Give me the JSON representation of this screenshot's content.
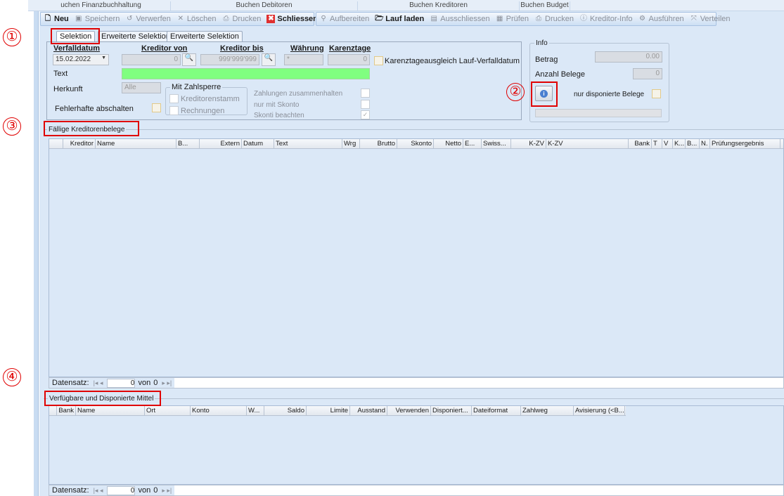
{
  "nav_tabs": [
    "uchen Finanzbuchhaltung",
    "Buchen Debitoren",
    "Buchen Kreditoren",
    "Buchen Budget"
  ],
  "toolbar1": [
    {
      "label": "Neu",
      "icon": "new-document-icon",
      "enabled": true
    },
    {
      "label": "Speichern",
      "icon": "save-icon",
      "enabled": false
    },
    {
      "label": "Verwerfen",
      "icon": "discard-icon",
      "enabled": false
    },
    {
      "label": "Löschen",
      "icon": "delete-x-icon",
      "enabled": false
    },
    {
      "label": "Drucken",
      "icon": "print-icon",
      "enabled": false
    },
    {
      "label": "Schliessen",
      "icon": "close-red-icon",
      "enabled": true
    }
  ],
  "toolbar2": [
    {
      "label": "Aufbereiten",
      "icon": "magnifier-icon",
      "enabled": false
    },
    {
      "label": "Lauf laden",
      "icon": "folder-icon",
      "enabled": true
    },
    {
      "label": "Ausschliessen",
      "icon": "exclude-icon",
      "enabled": false
    },
    {
      "label": "Prüfen",
      "icon": "check-icon",
      "enabled": false
    },
    {
      "label": "Drucken",
      "icon": "print-icon",
      "enabled": false
    },
    {
      "label": "Kreditor-Info",
      "icon": "info-icon",
      "enabled": false
    },
    {
      "label": "Ausführen",
      "icon": "gear-icon",
      "enabled": false
    },
    {
      "label": "Verteilen",
      "icon": "distribute-icon",
      "enabled": false
    }
  ],
  "form_tabs": [
    "Selektion",
    "Erweiterte Selektion",
    "Erweiterte Selektion"
  ],
  "selection": {
    "verfalldatum_label": "Verfalldatum",
    "verfalldatum": "15.02.2022",
    "kreditor_von_label": "Kreditor von",
    "kreditor_von": "0",
    "kreditor_bis_label": "Kreditor bis",
    "kreditor_bis": "999'999'999",
    "waehrung_label": "Währung",
    "waehrung": "*",
    "karenztage_label": "Karenztage",
    "karenztage": "0",
    "karenz_ausgleich_label": "Karenztageausgleich Lauf-Verfalldatum",
    "text_label": "Text",
    "text_value": "",
    "herkunft_label": "Herkunft",
    "herkunft": "Alle",
    "fehlerhafte_label": "Fehlerhafte abschalten",
    "zahlsperre_title": "Mit Zahlsperre",
    "kreditorenstamm_label": "Kreditorenstamm",
    "rechnungen_label": "Rechnungen",
    "zahlungen_label": "Zahlungen zusammenhalten",
    "skonto_label": "nur mit Skonto",
    "skonti_label": "Skonti beachten",
    "skonti_checked": true
  },
  "info": {
    "title": "Info",
    "betrag_label": "Betrag",
    "betrag": "0.00",
    "anzahl_label": "Anzahl Belege",
    "anzahl": "0",
    "nur_disponierte_label": "nur disponierte Belege",
    "progress": 0
  },
  "grid1": {
    "title": "Fällige Kreditorenbelege",
    "columns": [
      "",
      "Kreditor",
      "Name",
      "B...",
      "Extern",
      "Datum",
      "Text",
      "Wrg",
      "Brutto",
      "Skonto",
      "Netto",
      "E...",
      "Swiss...",
      "K-ZV",
      "K-ZV",
      "Bank",
      "T",
      "V",
      "K...",
      "B...",
      "N.",
      "Prüfungsergebnis"
    ],
    "datensatz_label": "Datensatz:",
    "current": "0",
    "von_label": "von",
    "total": "0"
  },
  "grid2": {
    "title": "Verfügbare und Disponierte Mittel",
    "columns": [
      "",
      "Bank",
      "Name",
      "Ort",
      "Konto",
      "W...",
      "Saldo",
      "Limite",
      "Ausstand",
      "Verwenden",
      "Disponiert...",
      "Dateiformat",
      "Zahlweg",
      "Avisierung (<B..."
    ],
    "datensatz_label": "Datensatz:",
    "current": "0",
    "von_label": "von",
    "total": "0"
  },
  "annotations": [
    "①",
    "②",
    "③",
    "④"
  ],
  "colors": {
    "text_field": "#80ff80",
    "annotation": "#e00000",
    "background": "#dbe8f7"
  }
}
